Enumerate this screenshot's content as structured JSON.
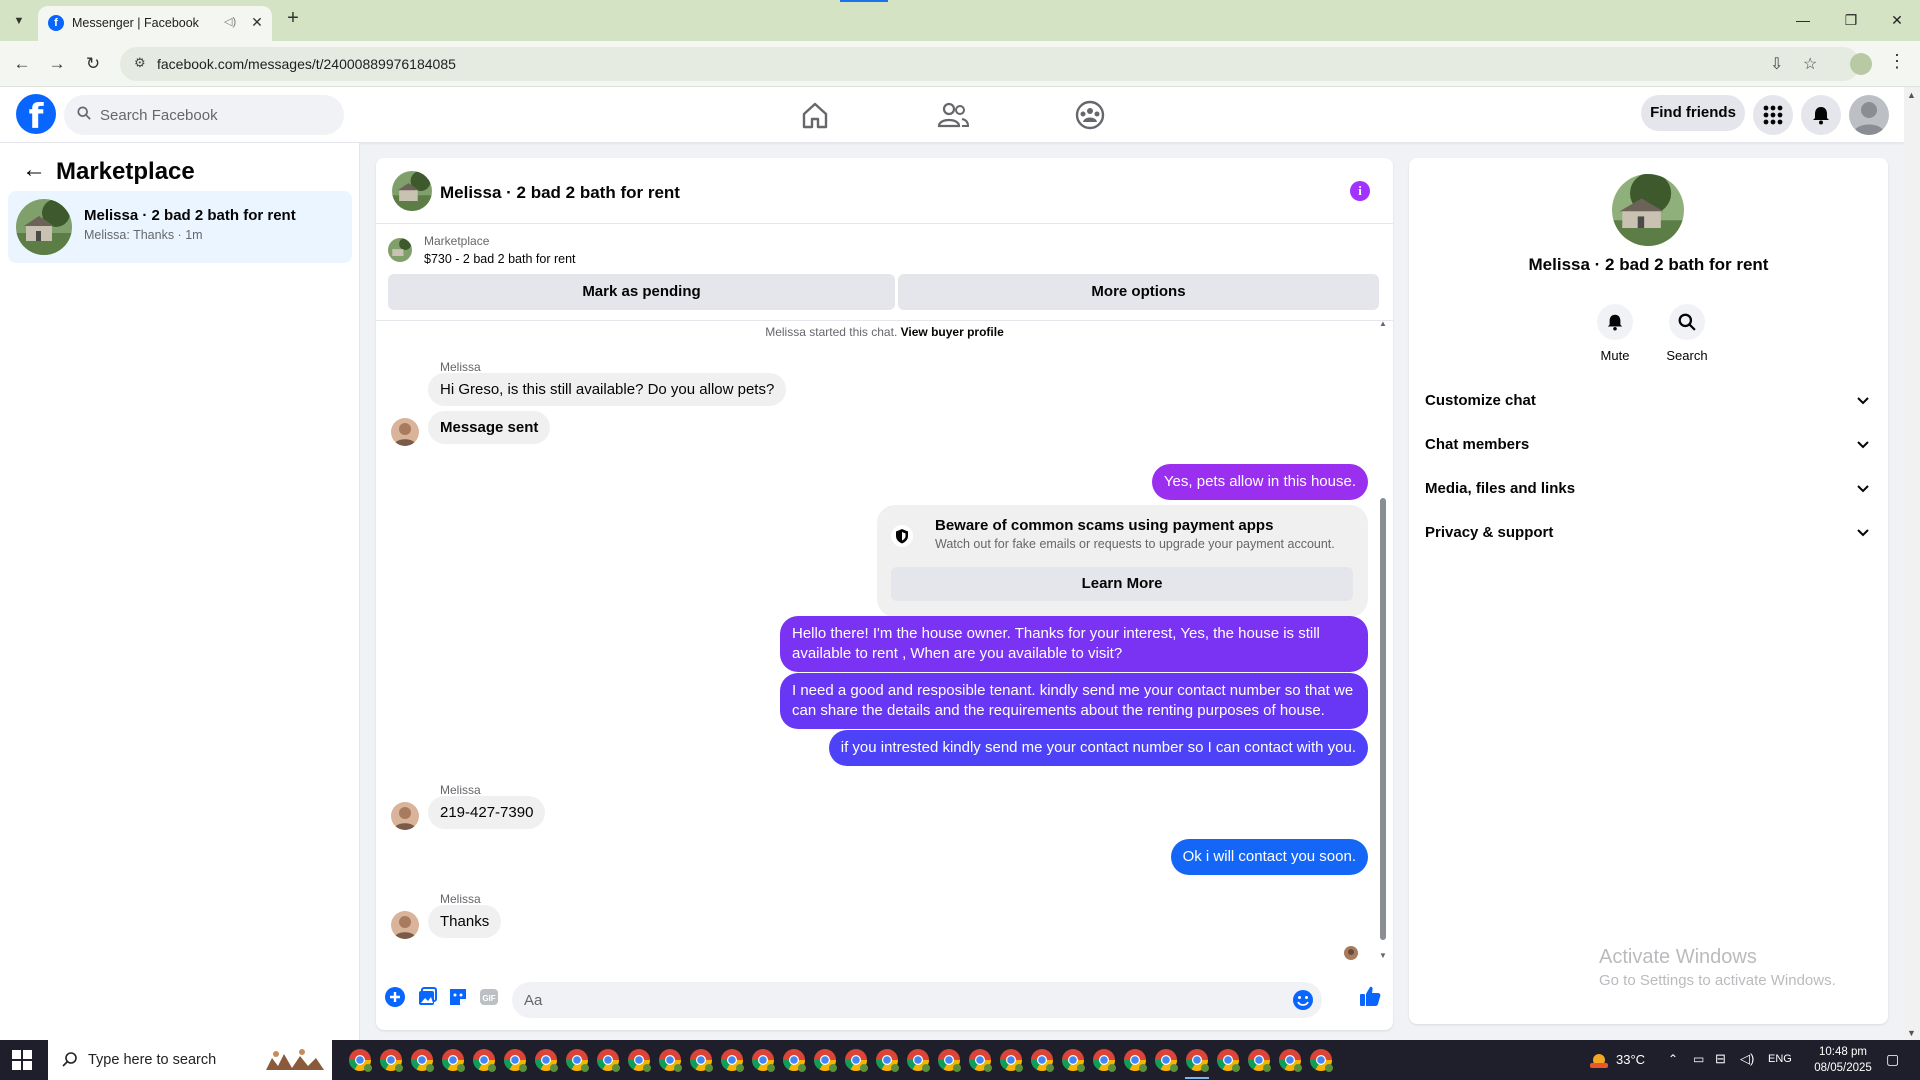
{
  "browser": {
    "tab_title": "Messenger | Facebook",
    "url": "facebook.com/messages/t/24000889976184085"
  },
  "fb": {
    "search_placeholder": "Search Facebook",
    "find_friends": "Find friends"
  },
  "sidebar": {
    "title": "Marketplace",
    "conversation": {
      "name": "Melissa · 2 bad 2 bath for rent",
      "preview": "Melissa: Thanks · 1m"
    }
  },
  "chat": {
    "title": "Melissa · 2 bad 2 bath for rent",
    "listing": {
      "label": "Marketplace",
      "price_title": "$730 - 2 bad 2 bath for rent",
      "mark_pending": "Mark as pending",
      "more_options": "More options"
    },
    "started_text": "Melissa started this chat.",
    "started_link": "View buyer profile",
    "messages": [
      {
        "sender": "Melissa",
        "dir": "in",
        "text": "Hi Greso, is this still available? Do you allow pets?"
      },
      {
        "dir": "in",
        "text": "Message sent"
      },
      {
        "dir": "out",
        "text": "Yes, pets allow in this house."
      },
      {
        "dir": "out",
        "text": "Hello there! I'm the house owner. Thanks for your interest, Yes, the house is still available to rent , When are you available to visit?"
      },
      {
        "dir": "out",
        "text": "I need a good and resposible tenant.  kindly send me your contact number so that we can share the details and the requirements about the renting purposes of house."
      },
      {
        "dir": "out",
        "text": "if you intrested kindly send me your contact number so I can contact with you."
      },
      {
        "sender": "Melissa",
        "dir": "in",
        "text": "219-427-7390"
      },
      {
        "dir": "out",
        "text": "Ok i will contact you soon."
      },
      {
        "sender": "Melissa",
        "dir": "in",
        "text": "Thanks"
      }
    ],
    "scam_notice": {
      "title": "Beware of common scams using payment apps",
      "description": "Watch out for fake emails or requests to upgrade your payment account.",
      "button": "Learn More"
    },
    "composer_placeholder": "Aa",
    "colors": {
      "out_purple": "#7b2ff7",
      "out_blue": "#0a7cff",
      "accent": "#0866ff",
      "info": "#a033ff"
    }
  },
  "details": {
    "name": "Melissa · 2 bad 2 bath for rent",
    "actions": {
      "mute": "Mute",
      "search": "Search"
    },
    "sections": [
      "Customize chat",
      "Chat members",
      "Media, files and links",
      "Privacy & support"
    ]
  },
  "watermark": {
    "line1": "Activate Windows",
    "line2": "Go to Settings to activate Windows."
  },
  "taskbar": {
    "search_placeholder": "Type here to search",
    "temperature": "33°C",
    "language": "ENG",
    "time": "10:48 pm",
    "date": "08/05/2025"
  }
}
